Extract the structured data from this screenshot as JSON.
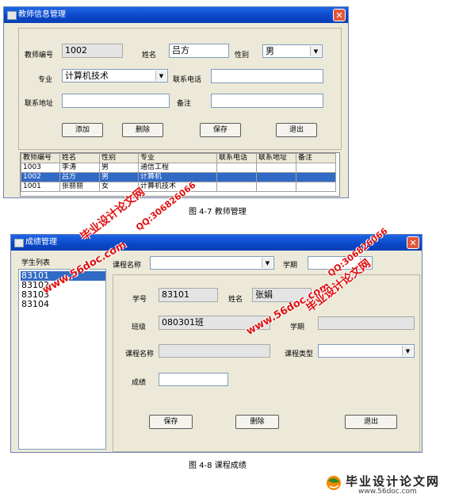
{
  "teacher_window": {
    "title": "教师信息管理",
    "labels": {
      "teacher_id": "教师编号",
      "name": "姓名",
      "gender": "性别",
      "major": "专业",
      "phone": "联系电话",
      "address": "联系地址",
      "remark": "备注"
    },
    "values": {
      "teacher_id": "1002",
      "name": "吕方",
      "gender": "男",
      "major": "计算机技术",
      "phone": "",
      "address": "",
      "remark": ""
    },
    "buttons": {
      "add": "添加",
      "delete": "删除",
      "save": "保存",
      "exit": "退出"
    },
    "table": {
      "headers": [
        "教师编号",
        "姓名",
        "性别",
        "专业",
        "联系电话",
        "联系地址",
        "备注"
      ],
      "rows": [
        [
          "1003",
          "李涛",
          "男",
          "通信工程",
          "",
          "",
          ""
        ],
        [
          "1002",
          "吕方",
          "男",
          "计算机",
          "",
          "",
          ""
        ],
        [
          "1001",
          "张丽丽",
          "女",
          "计算机技术",
          "",
          "",
          ""
        ]
      ],
      "selected_row": 1
    }
  },
  "caption1": "图 4-7  教师管理",
  "grade_window": {
    "title": "成绩管理",
    "student_list_label": "学生列表",
    "students": [
      "83101",
      "83102",
      "83103",
      "83104"
    ],
    "selected_student": 0,
    "top_labels": {
      "course_name": "课程名称",
      "term": "学期"
    },
    "top_values": {
      "course_name": "",
      "term": ""
    },
    "labels": {
      "student_id": "学号",
      "name": "姓名",
      "class": "班级",
      "term": "学期",
      "course_name": "课程名称",
      "course_type": "课程类型",
      "score": "成绩"
    },
    "values": {
      "student_id": "83101",
      "name": "张娟",
      "class": "080301班",
      "term": "",
      "course_name": "",
      "course_type": "",
      "score": ""
    },
    "buttons": {
      "save": "保存",
      "delete": "删除",
      "exit": "退出"
    }
  },
  "caption2": "图 4-8  课程成绩",
  "watermarks": {
    "site_name": "毕业设计论文网",
    "site_url": "www.56doc.com",
    "qq": "QQ:306826066",
    "footer_url": "www.56doc.com"
  },
  "colors": {
    "title_bar": "#0a46c8",
    "window_bg": "#ece9d8",
    "selection": "#316ac5",
    "watermark": "#e01010",
    "close_button": "#e0583a"
  }
}
